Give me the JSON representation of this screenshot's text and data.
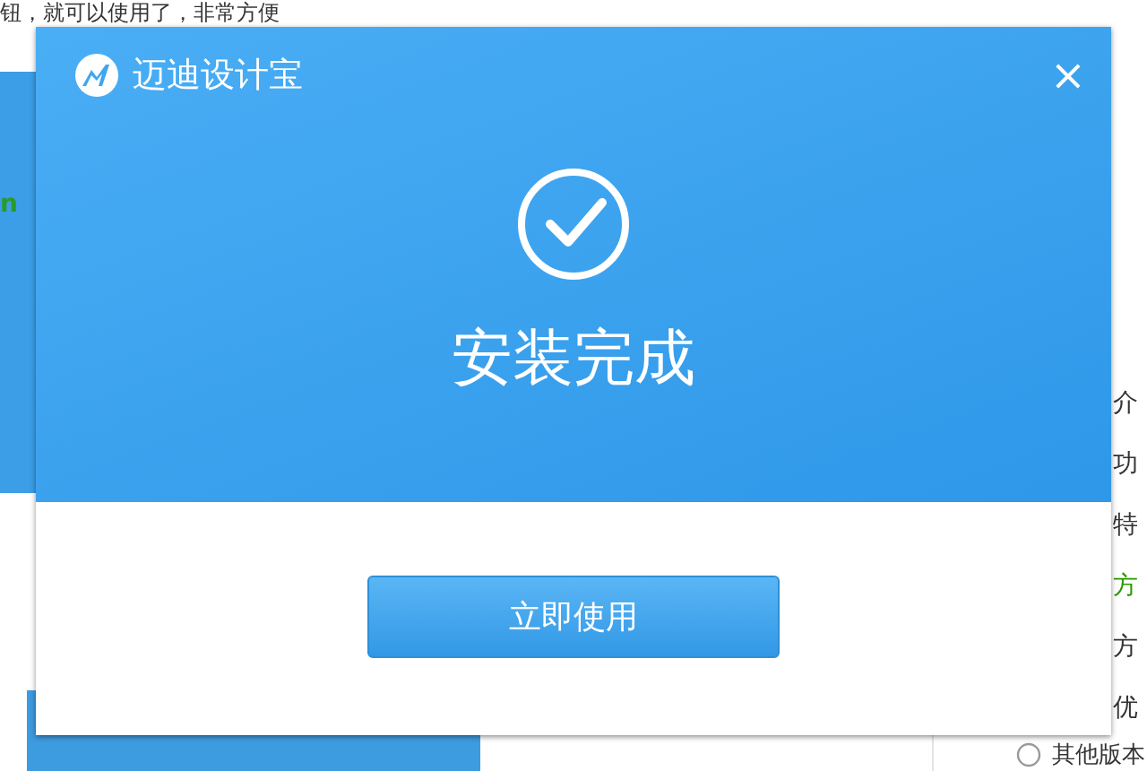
{
  "background_page": {
    "intro_line": "钮，就可以使用了，非常方便",
    "side_text": "n",
    "nav_items": [
      {
        "label": "介",
        "selected": false
      },
      {
        "label": "功",
        "selected": false
      },
      {
        "label": "特",
        "selected": false
      },
      {
        "label": "方",
        "selected": true
      },
      {
        "label": "方",
        "selected": false
      },
      {
        "label": "优",
        "selected": false
      }
    ],
    "other_versions": "其他版本"
  },
  "dialog": {
    "title": "迈迪设计宝",
    "close": "×",
    "message": "安装完成",
    "button": "立即使用"
  }
}
